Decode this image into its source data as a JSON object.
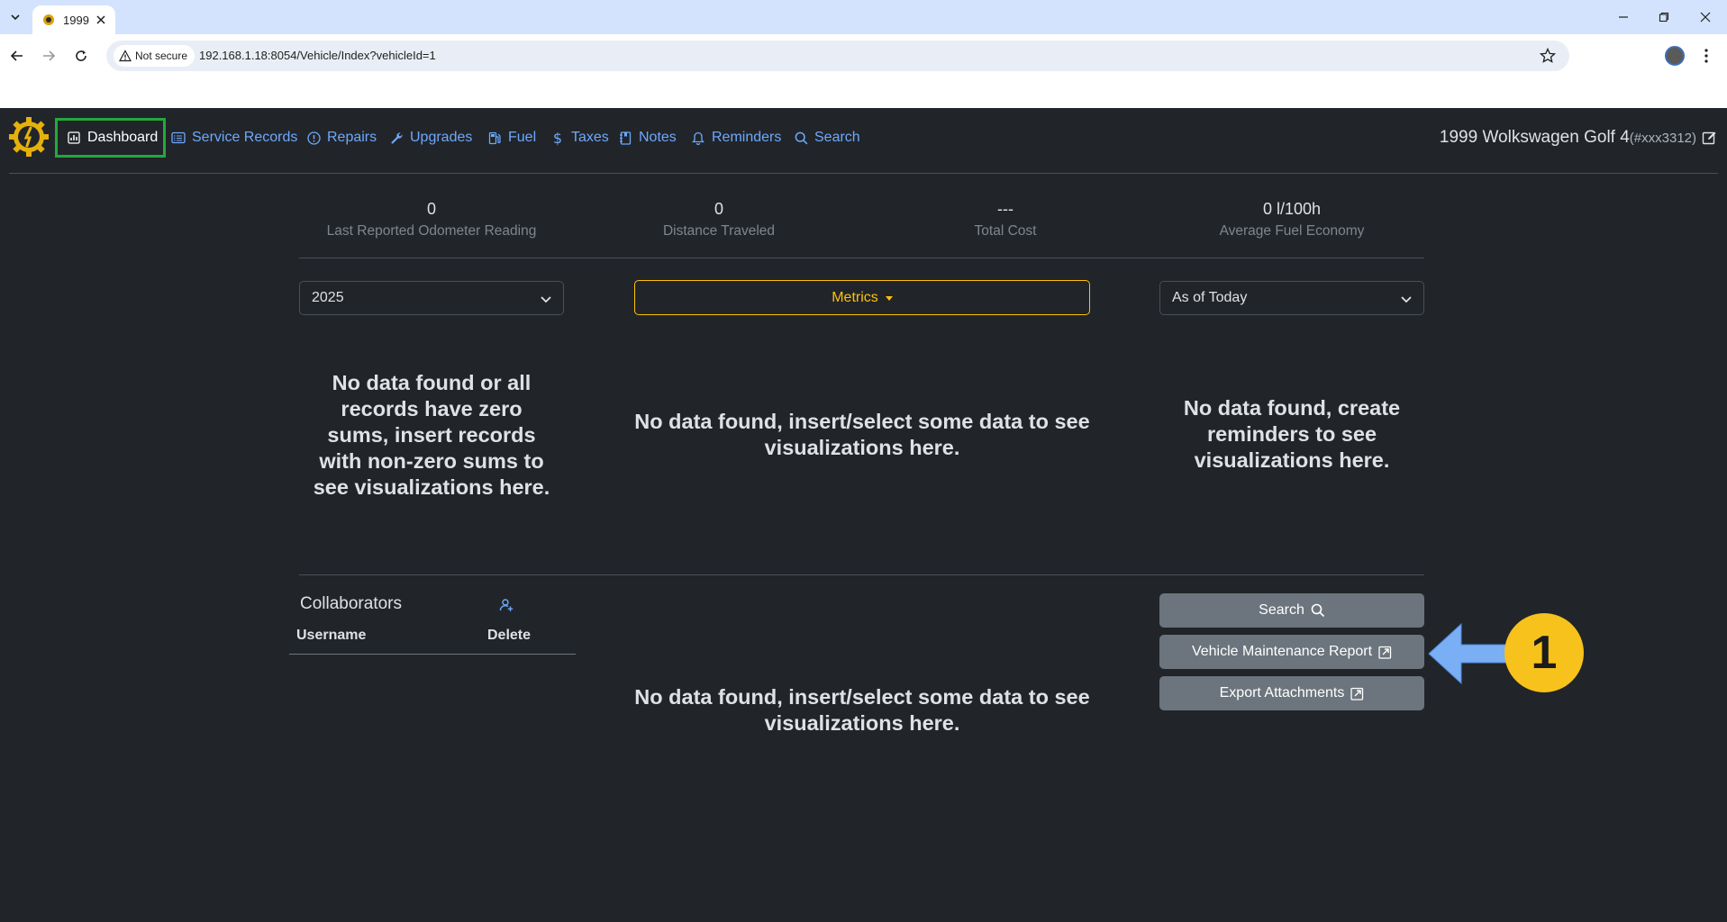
{
  "browser": {
    "tab_title": "1999",
    "security_label": "Not secure",
    "url": "192.168.1.18:8054/Vehicle/Index?vehicleId=1"
  },
  "nav": {
    "items": [
      {
        "label": "Dashboard",
        "icon": "bar-chart-icon",
        "active": true
      },
      {
        "label": "Service Records",
        "icon": "card-list-icon"
      },
      {
        "label": "Repairs",
        "icon": "exclamation-circle-icon"
      },
      {
        "label": "Upgrades",
        "icon": "wrench-icon"
      },
      {
        "label": "Fuel",
        "icon": "fuel-pump-icon"
      },
      {
        "label": "Taxes",
        "icon": "dollar-icon"
      },
      {
        "label": "Notes",
        "icon": "journal-icon"
      },
      {
        "label": "Reminders",
        "icon": "bell-icon"
      },
      {
        "label": "Search",
        "icon": "search-icon"
      }
    ],
    "vehicle_title": "1999 Wolkswagen Golf 4",
    "vehicle_tag": "(#xxx3312)"
  },
  "stats": [
    {
      "value": "0",
      "label": "Last Reported Odometer Reading"
    },
    {
      "value": "0",
      "label": "Distance Traveled"
    },
    {
      "value": "---",
      "label": "Total Cost"
    },
    {
      "value": "0 l/100h",
      "label": "Average Fuel Economy"
    }
  ],
  "controls": {
    "year_value": "2025",
    "metrics_label": "Metrics",
    "period_value": "As of Today"
  },
  "empty_states": {
    "cost_chart": "No data found or all records have zero sums, insert records with non-zero sums to see visualizations here.",
    "metrics_chart": "No data found, insert/select some data to see visualizations here.",
    "reminders_chart": "No data found, create reminders to see visualizations here.",
    "lower_chart": "No data found, insert/select some data to see visualizations here."
  },
  "collaborators": {
    "title": "Collaborators",
    "col_username": "Username",
    "col_delete": "Delete"
  },
  "actions": {
    "search": "Search",
    "maintenance_report": "Vehicle Maintenance Report",
    "export_attachments": "Export Attachments"
  },
  "annotation": {
    "step_number": "1",
    "arrow_color": "#7aaef5",
    "badge_color": "#f7c21b",
    "highlight_color": "#22a93b"
  },
  "colors": {
    "background": "#212529",
    "link": "#6ea8fe",
    "warning": "#ffc107",
    "secondary_button": "#6c757d"
  }
}
